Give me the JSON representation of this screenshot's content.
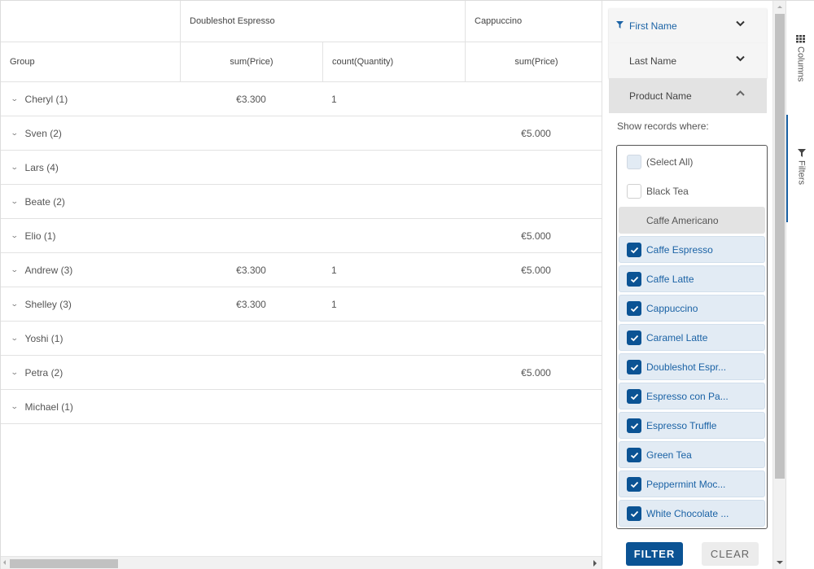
{
  "grid": {
    "header": {
      "group_label": "Group",
      "column_groups": [
        {
          "label": "Doubleshot Espresso",
          "subcolumns": [
            "sum(Price)",
            "count(Quantity)"
          ]
        },
        {
          "label": "Cappuccino",
          "subcolumns": [
            "sum(Price)"
          ]
        }
      ]
    },
    "rows": [
      {
        "group": "Cheryl (1)",
        "espresso_sum": "€3.300",
        "espresso_count": "1",
        "cappuccino_sum": ""
      },
      {
        "group": "Sven (2)",
        "espresso_sum": "",
        "espresso_count": "",
        "cappuccino_sum": "€5.000"
      },
      {
        "group": "Lars (4)",
        "espresso_sum": "",
        "espresso_count": "",
        "cappuccino_sum": ""
      },
      {
        "group": "Beate (2)",
        "espresso_sum": "",
        "espresso_count": "",
        "cappuccino_sum": ""
      },
      {
        "group": "Elio (1)",
        "espresso_sum": "",
        "espresso_count": "",
        "cappuccino_sum": "€5.000"
      },
      {
        "group": "Andrew (3)",
        "espresso_sum": "€3.300",
        "espresso_count": "1",
        "cappuccino_sum": "€5.000"
      },
      {
        "group": "Shelley (3)",
        "espresso_sum": "€3.300",
        "espresso_count": "1",
        "cappuccino_sum": ""
      },
      {
        "group": "Yoshi (1)",
        "espresso_sum": "",
        "espresso_count": "",
        "cappuccino_sum": ""
      },
      {
        "group": "Petra (2)",
        "espresso_sum": "",
        "espresso_count": "",
        "cappuccino_sum": "€5.000"
      },
      {
        "group": "Michael (1)",
        "espresso_sum": "",
        "espresso_count": "",
        "cappuccino_sum": ""
      }
    ]
  },
  "filter_panel": {
    "accordions": [
      {
        "label": "First Name",
        "filtered": true,
        "expanded": false
      },
      {
        "label": "Last Name",
        "filtered": false,
        "expanded": false
      },
      {
        "label": "Product Name",
        "filtered": false,
        "expanded": true
      }
    ],
    "show_records_label": "Show records where:",
    "options": [
      {
        "label": "(Select All)",
        "state": "partial"
      },
      {
        "label": "Black Tea",
        "state": "unchecked"
      },
      {
        "label": "Caffe Americano",
        "state": "hover"
      },
      {
        "label": "Caffe Espresso",
        "state": "checked"
      },
      {
        "label": "Caffe Latte",
        "state": "checked"
      },
      {
        "label": "Cappuccino",
        "state": "checked"
      },
      {
        "label": "Caramel Latte",
        "state": "checked"
      },
      {
        "label": "Doubleshot Espr...",
        "state": "checked"
      },
      {
        "label": "Espresso con Pa...",
        "state": "checked"
      },
      {
        "label": "Espresso Truffle",
        "state": "checked"
      },
      {
        "label": "Green Tea",
        "state": "checked"
      },
      {
        "label": "Peppermint Moc...",
        "state": "checked"
      },
      {
        "label": "White Chocolate ...",
        "state": "checked"
      }
    ],
    "filter_button": "FILTER",
    "clear_button": "CLEAR"
  },
  "sidebar": {
    "tabs": [
      {
        "label": "Columns",
        "icon": "grid-icon",
        "active": false
      },
      {
        "label": "Filters",
        "icon": "funnel-icon",
        "active": true
      }
    ]
  },
  "colors": {
    "accent": "#0b5394",
    "accent_text": "#1a62a5",
    "checked_row_bg": "#e2ebf4"
  }
}
